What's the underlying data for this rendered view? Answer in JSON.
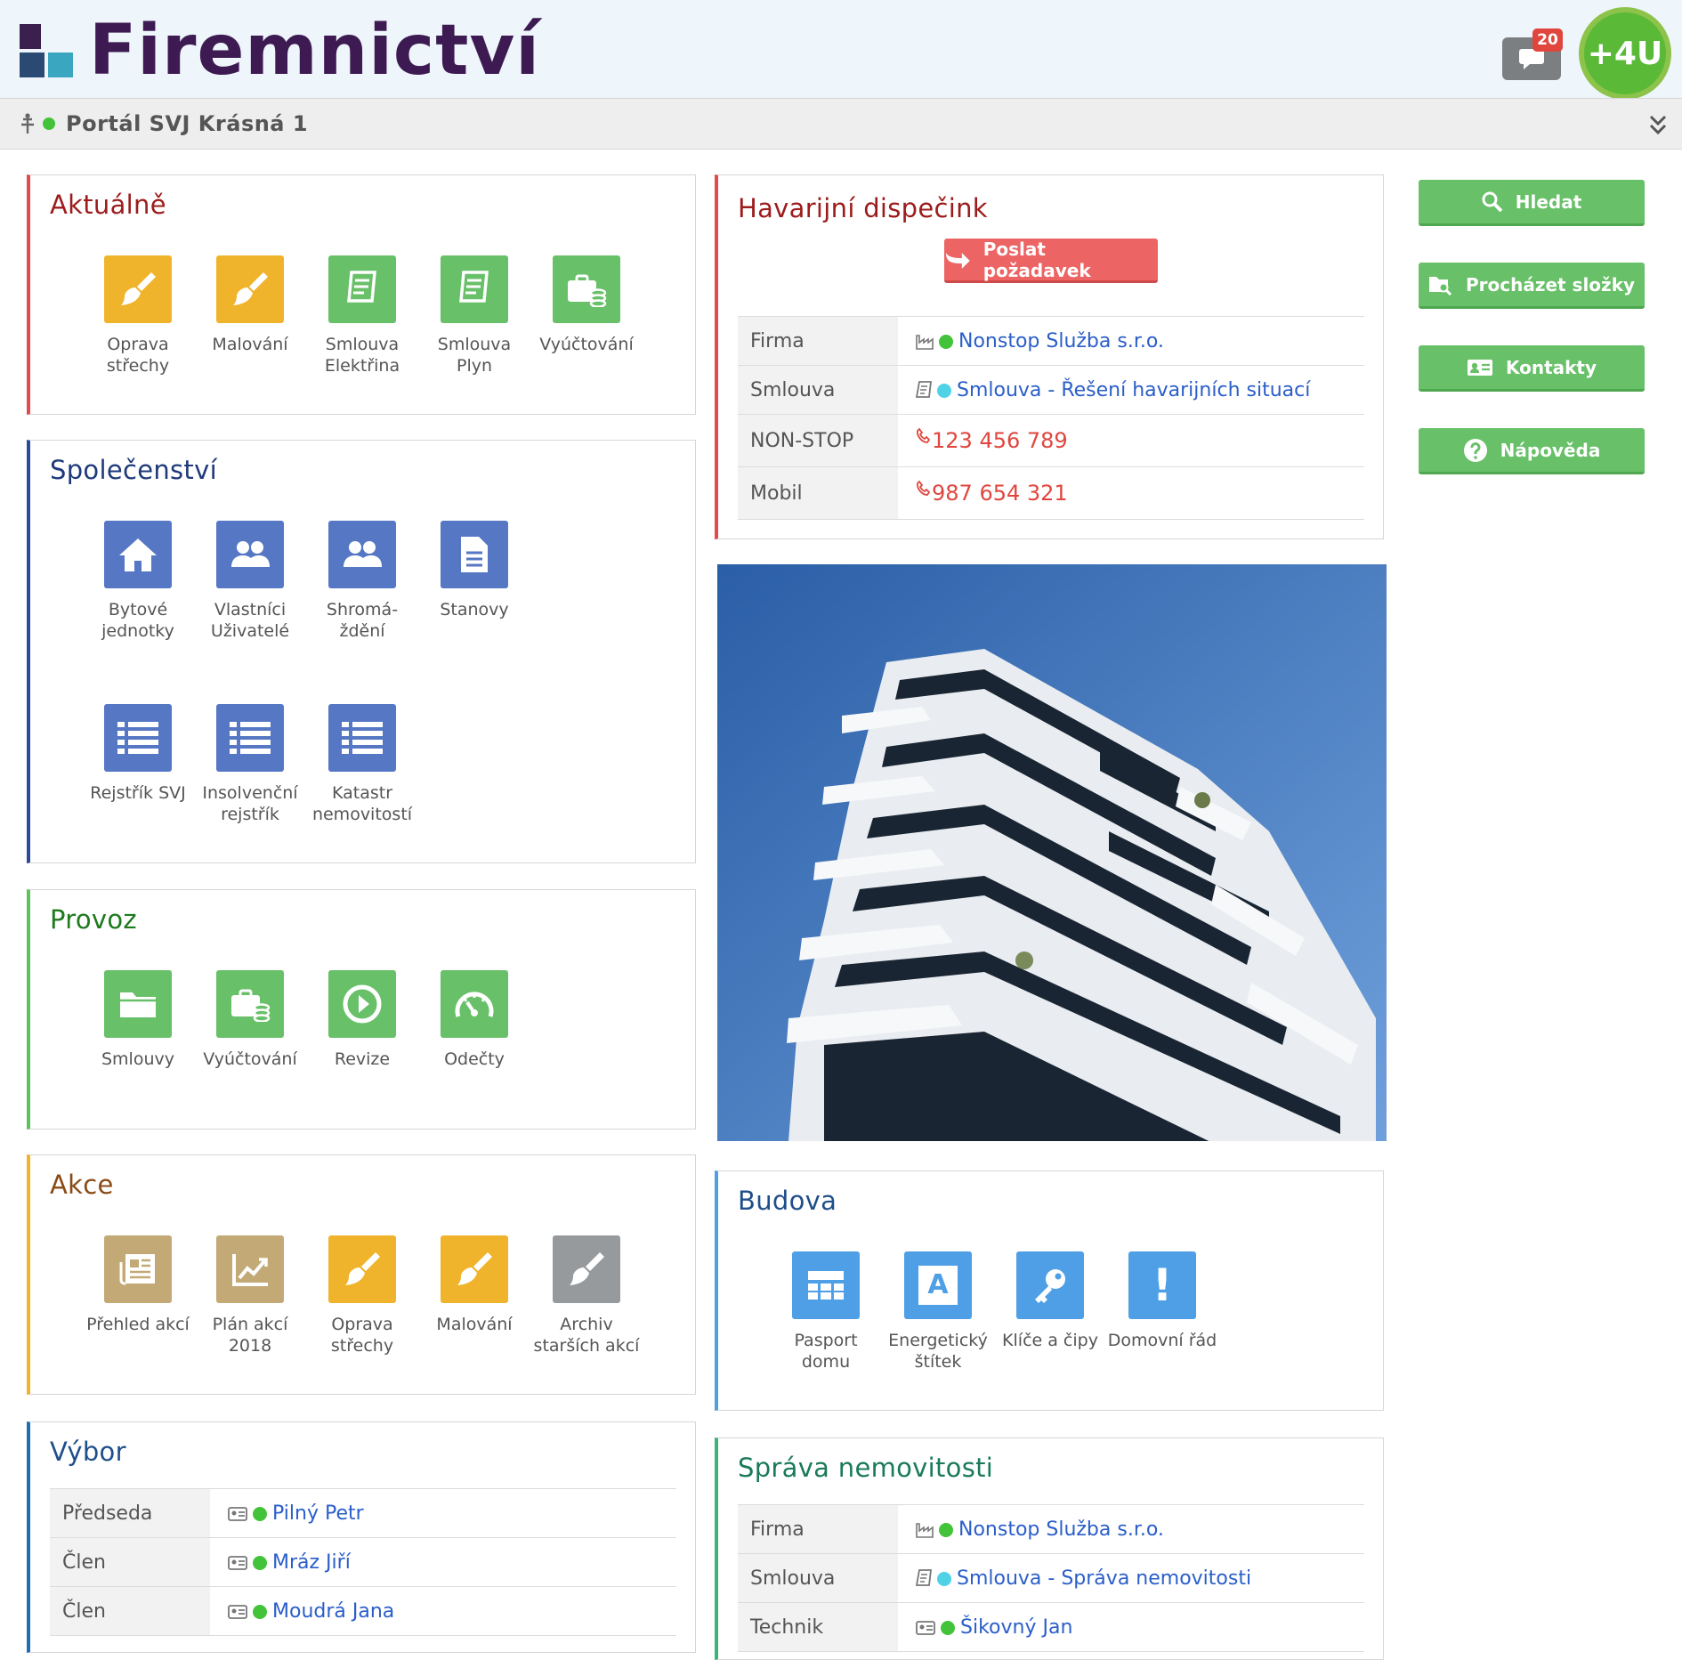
{
  "header": {
    "app_name": "Firemnictví",
    "chat_count": "20",
    "plus_label": "+4U",
    "portal_title": "Portál SVJ Krásná 1"
  },
  "aktualne": {
    "title": "Aktuálně",
    "tiles": [
      {
        "label": "Oprava střechy",
        "icon": "brush-icon",
        "color": "#f0b42c"
      },
      {
        "label": "Malování",
        "icon": "brush-icon",
        "color": "#f0b42c"
      },
      {
        "label": "Smlouva Elektřina",
        "icon": "contract-icon",
        "color": "#68c068"
      },
      {
        "label": "Smlouva Plyn",
        "icon": "contract-icon",
        "color": "#68c068"
      },
      {
        "label": "Vyúčtování",
        "icon": "billing-icon",
        "color": "#68c068"
      }
    ]
  },
  "spolecenstvi": {
    "title": "Společenství",
    "tiles": [
      {
        "label": "Bytové jednotky",
        "icon": "house-icon"
      },
      {
        "label": "Vlastníci Uživatelé",
        "icon": "users-icon"
      },
      {
        "label": "Shromá- ždění",
        "icon": "users-icon"
      },
      {
        "label": "Stanovy",
        "icon": "document-icon"
      },
      {
        "label": "Rejstřík SVJ",
        "icon": "list-icon"
      },
      {
        "label": "Insolvenční rejstřík",
        "icon": "list-icon"
      },
      {
        "label": "Katastr nemovitostí",
        "icon": "list-icon"
      }
    ]
  },
  "provoz": {
    "title": "Provoz",
    "tiles": [
      {
        "label": "Smlouvy",
        "icon": "folder-icon"
      },
      {
        "label": "Vyúčtování",
        "icon": "billing-icon"
      },
      {
        "label": "Revize",
        "icon": "revision-icon"
      },
      {
        "label": "Odečty",
        "icon": "gauge-icon"
      }
    ]
  },
  "akce": {
    "title": "Akce",
    "tiles": [
      {
        "label": "Přehled akcí",
        "icon": "newspaper-icon"
      },
      {
        "label": "Plán akcí 2018",
        "icon": "chart-icon"
      },
      {
        "label": "Oprava střechy",
        "icon": "brush-icon"
      },
      {
        "label": "Malování",
        "icon": "brush-icon"
      },
      {
        "label": "Archiv starších akcí",
        "icon": "brush-icon"
      }
    ]
  },
  "vybor": {
    "title": "Výbor",
    "rows": [
      {
        "key": "Předseda",
        "value": "Pilný Petr"
      },
      {
        "key": "Člen",
        "value": "Mráz Jiří"
      },
      {
        "key": "Člen",
        "value": "Moudrá Jana"
      }
    ]
  },
  "havarijni": {
    "title": "Havarijní dispečink",
    "button": "Poslat požadavek",
    "rows": [
      {
        "key": "Firma",
        "value": "Nonstop Služba s.r.o."
      },
      {
        "key": "Smlouva",
        "value": "Smlouva - Řešení havarijních situací"
      },
      {
        "key": "NON-STOP",
        "value": "123 456 789"
      },
      {
        "key": "Mobil",
        "value": "987 654 321"
      }
    ]
  },
  "budova": {
    "title": "Budova",
    "tiles": [
      {
        "label": "Pasport domu",
        "icon": "grid-icon"
      },
      {
        "label": "Energetický štítek",
        "icon": "energy-label-icon",
        "glyph": "A"
      },
      {
        "label": "Klíče a čipy",
        "icon": "key-icon"
      },
      {
        "label": "Domovní řád",
        "icon": "exclamation-icon",
        "glyph": "!"
      }
    ]
  },
  "sprava": {
    "title": "Správa nemovitosti",
    "rows": [
      {
        "key": "Firma",
        "value": "Nonstop Služba s.r.o."
      },
      {
        "key": "Smlouva",
        "value": "Smlouva - Správa nemovitosti"
      },
      {
        "key": "Technik",
        "value": "Šikovný Jan"
      }
    ]
  },
  "sidebar": {
    "buttons": [
      {
        "label": "Hledat",
        "icon": "search-icon"
      },
      {
        "label": "Procházet složky",
        "icon": "folder-search-icon"
      },
      {
        "label": "Kontakty",
        "icon": "contact-card-icon"
      },
      {
        "label": "Nápověda",
        "icon": "help-icon"
      }
    ]
  },
  "colors": {
    "aktualne": "#c0392b",
    "spolecenstvi": "#2c4a9a",
    "provoz": "#2e9a3a",
    "akce": "#e0a82c",
    "vybor": "#1f6eb3",
    "havarijni": "#c0392b",
    "budova": "#4e9fe6",
    "sprava": "#3cb37a"
  }
}
